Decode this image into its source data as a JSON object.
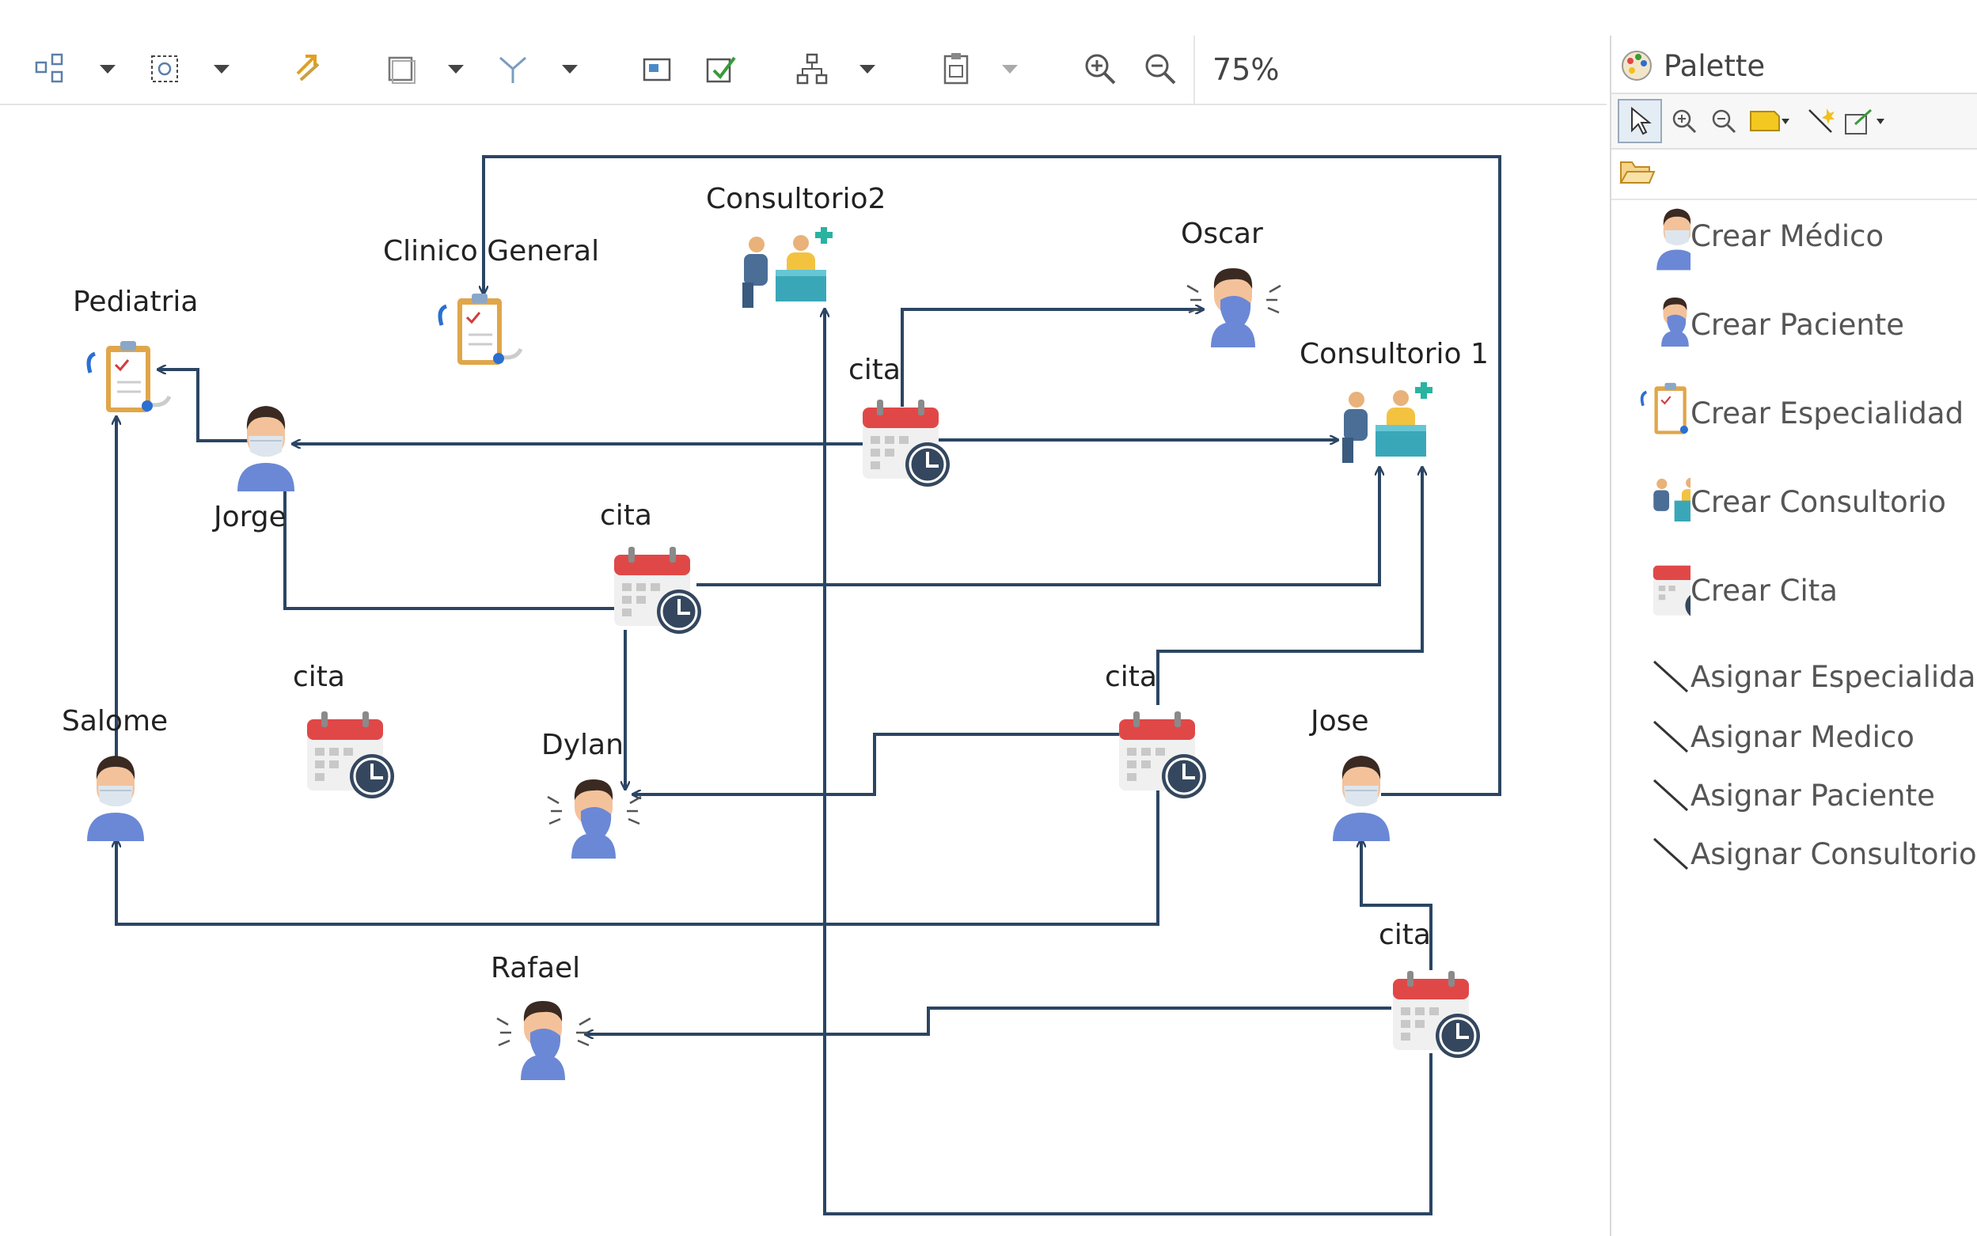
{
  "toolbar": {
    "zoom_value": "75%",
    "buttons": [
      "arrange-all",
      "arrange-selection",
      "refresh",
      "select",
      "filter",
      "layers",
      "validate",
      "layout",
      "export"
    ],
    "zoom_in_icon": "zoom-in-icon",
    "zoom_out_icon": "zoom-out-icon"
  },
  "diagram": {
    "nodes": {
      "clinico_general": "Clinico General",
      "consultorio2": "Consultorio2",
      "oscar": "Oscar",
      "pediatria": "Pediatria",
      "consultorio1": "Consultorio 1",
      "jorge": "Jorge",
      "cita_top": "cita",
      "cita_mid": "cita",
      "cita_left": "cita",
      "cita_right": "cita",
      "salome": "Salome",
      "dylan": "Dylan",
      "jose": "Jose",
      "rafael": "Rafael",
      "cita_bottom": "cita"
    },
    "edge_color": "#2b4563"
  },
  "palette": {
    "title": "Palette",
    "items": [
      {
        "label": "Crear Médico",
        "icon": "doctor-icon"
      },
      {
        "label": "Crear Paciente",
        "icon": "patient-icon"
      },
      {
        "label": "Crear Especialidad",
        "icon": "clipboard-icon"
      },
      {
        "label": "Crear Consultorio",
        "icon": "office-icon"
      },
      {
        "label": "Crear Cita",
        "icon": "calendar-icon"
      }
    ],
    "links": [
      {
        "label": "Asignar Especialidad",
        "icon": "connection-icon"
      },
      {
        "label": "Asignar Medico",
        "icon": "connection-icon"
      },
      {
        "label": "Asignar Paciente",
        "icon": "connection-icon"
      },
      {
        "label": "Asignar Consultorio",
        "icon": "connection-icon"
      }
    ]
  }
}
